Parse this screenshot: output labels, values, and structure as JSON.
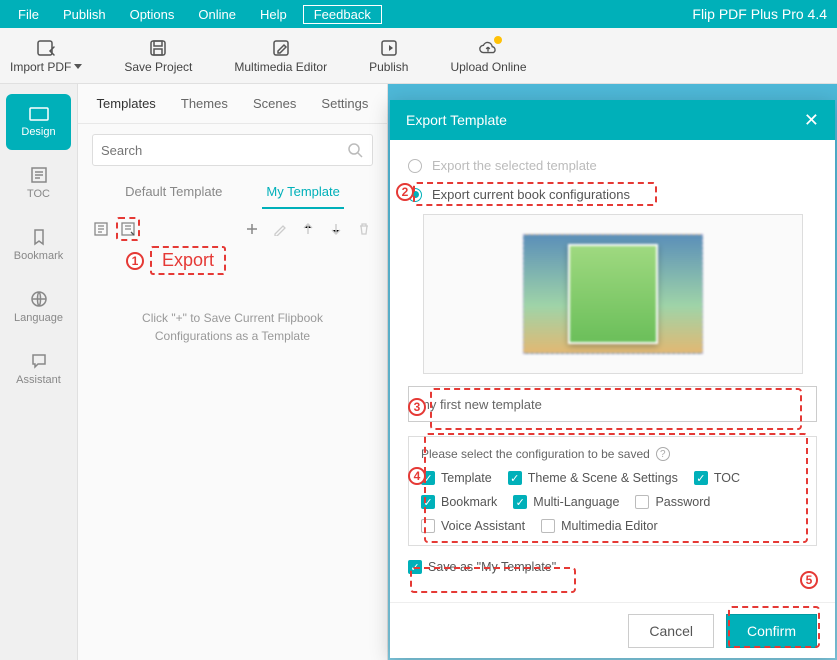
{
  "menubar": {
    "file": "File",
    "publish": "Publish",
    "options": "Options",
    "online": "Online",
    "help": "Help",
    "feedback": "Feedback",
    "app_title": "Flip PDF Plus Pro 4.4"
  },
  "toolbar": {
    "import_pdf": "Import PDF",
    "save_project": "Save Project",
    "multimedia_editor": "Multimedia Editor",
    "publish": "Publish",
    "upload_online": "Upload Online"
  },
  "sidebar": {
    "design": "Design",
    "toc": "TOC",
    "bookmark": "Bookmark",
    "language": "Language",
    "assistant": "Assistant"
  },
  "panel": {
    "tabs": {
      "templates": "Templates",
      "themes": "Themes",
      "scenes": "Scenes",
      "settings": "Settings"
    },
    "search_placeholder": "Search",
    "subtabs": {
      "default": "Default Template",
      "my": "My Template"
    },
    "empty_msg": "Click \"+\" to Save Current Flipbook Configurations as a Template"
  },
  "annot": {
    "export_label": "Export",
    "n1": "1",
    "n2": "2",
    "n3": "3",
    "n4": "4",
    "n5": "5"
  },
  "modal": {
    "title": "Export Template",
    "opt_selected": "Export the selected template",
    "opt_current": "Export current book configurations",
    "name_value": "my first new template",
    "config_title": "Please select the configuration to be saved",
    "checks": {
      "template": "Template",
      "theme_scene_settings": "Theme & Scene & Settings",
      "toc": "TOC",
      "bookmark": "Bookmark",
      "multi_language": "Multi-Language",
      "password": "Password",
      "voice_assistant": "Voice Assistant",
      "multimedia_editor": "Multimedia Editor"
    },
    "save_as": "Save as \"My Template\"",
    "cancel": "Cancel",
    "confirm": "Confirm"
  }
}
